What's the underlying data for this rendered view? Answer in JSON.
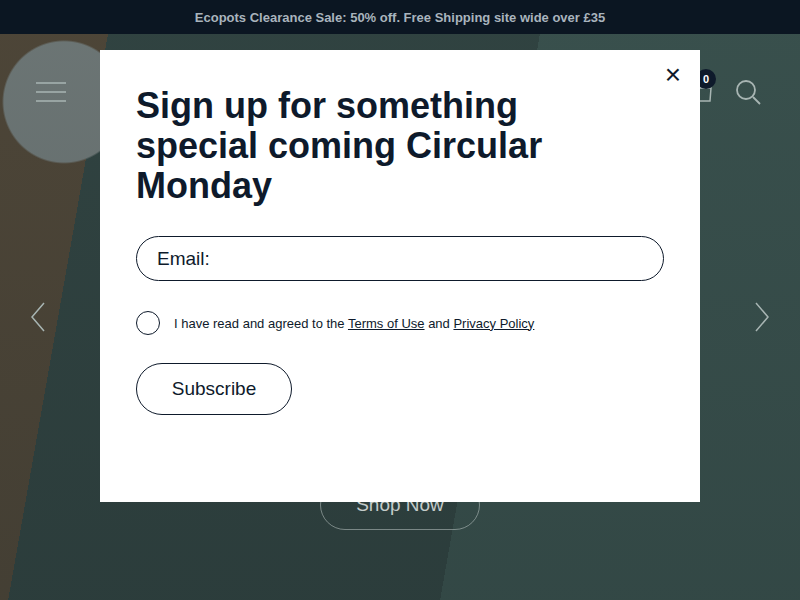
{
  "announcement": {
    "text": "Ecopots Clearance Sale: 50% off. Free Shipping site wide over £35"
  },
  "header": {
    "cart_count": "0"
  },
  "hero": {
    "button": "Shop Now"
  },
  "modal": {
    "close": "×",
    "title": "Sign up for something special coming Circular Monday",
    "email": {
      "placeholder": "Email:"
    },
    "consent": {
      "checked": false,
      "parts": [
        {
          "text": "I have read and agreed to the ",
          "link": false
        },
        {
          "text": "Terms of Use",
          "link": true
        },
        {
          "text": " and ",
          "link": false
        },
        {
          "text": "Privacy Policy",
          "link": true
        }
      ]
    },
    "button": "Subscribe"
  }
}
